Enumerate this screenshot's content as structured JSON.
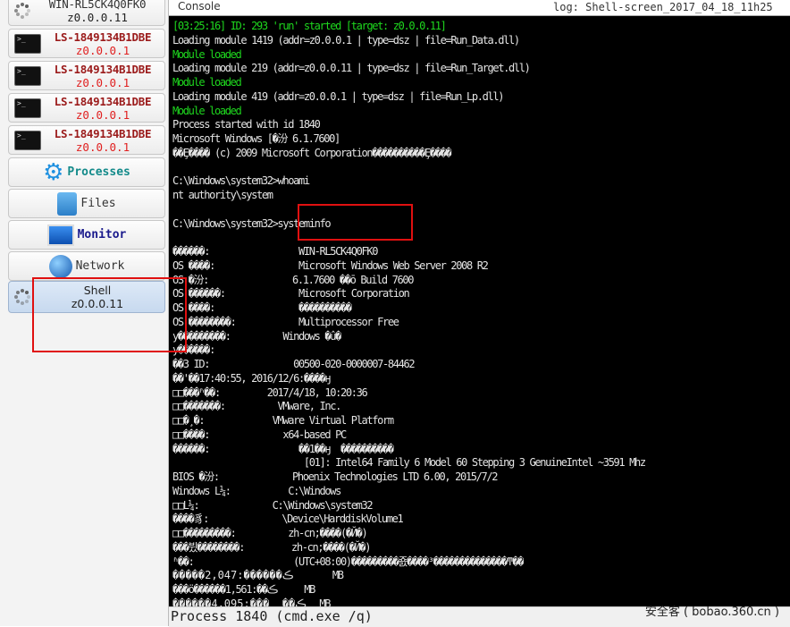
{
  "sidebar": {
    "hosts": [
      {
        "name": "WIN-RL5CK4Q0FK0",
        "addr": "z0.0.0.11",
        "icon": "spinner-icon"
      },
      {
        "name": "LS-1849134B1DBE",
        "addr": "z0.0.0.1",
        "icon": "terminal-icon"
      },
      {
        "name": "LS-1849134B1DBE",
        "addr": "z0.0.0.1",
        "icon": "terminal-icon"
      },
      {
        "name": "LS-1849134B1DBE",
        "addr": "z0.0.0.1",
        "icon": "terminal-icon"
      },
      {
        "name": "LS-1849134B1DBE",
        "addr": "z0.0.0.1",
        "icon": "terminal-icon"
      }
    ],
    "nav": [
      {
        "label": "Processes",
        "icon": "gear-icon",
        "color": "#138a8a"
      },
      {
        "label": "Files",
        "icon": "file-cabinet-icon",
        "color": "#333333"
      },
      {
        "label": "Monitor",
        "icon": "monitor-icon",
        "color": "#1a1a8c"
      },
      {
        "label": "Network",
        "icon": "globe-icon",
        "color": "#333333"
      }
    ],
    "selected": {
      "label": "Shell",
      "addr": "z0.0.0.11",
      "icon": "spinner-icon"
    }
  },
  "console": {
    "title": "Console",
    "log": "log: Shell-screen_2017_04_18_11h25",
    "lines": [
      {
        "t": "[03:25:16] ID: 293 'run' started [target: z0.0.0.11]",
        "c": "g"
      },
      {
        "t": "Loading module 1419 (addr=z0.0.0.1 | type=dsz | file=Run_Data.dll)"
      },
      {
        "t": "Module loaded",
        "c": "g"
      },
      {
        "t": "Loading module 219 (addr=z0.0.0.11 | type=dsz | file=Run_Target.dll)"
      },
      {
        "t": "Module loaded",
        "c": "g"
      },
      {
        "t": "Loading module 419 (addr=z0.0.0.1 | type=dsz | file=Run_Lp.dll)"
      },
      {
        "t": "Module loaded",
        "c": "g"
      },
      {
        "t": "Process started with id 1840"
      },
      {
        "t": "Microsoft Windows [�汾 6.1.7600]"
      },
      {
        "t": "��Ȩ���� (c) 2009 Microsoft Corporation����������Ȩ����"
      },
      {
        "t": ""
      },
      {
        "t": "C:\\Windows\\system32>whoami"
      },
      {
        "t": "nt authority\\system"
      },
      {
        "t": ""
      },
      {
        "t": "C:\\Windows\\system32>systeminfo"
      },
      {
        "t": ""
      },
      {
        "t": "������:                 WIN-RL5CK4Q0FK0"
      },
      {
        "t": "OS ����:                Microsoft Windows Web Server 2008 R2"
      },
      {
        "t": "OS �汾:                6.1.7600 ��ō Build 7600"
      },
      {
        "t": "OS ������:              Microsoft Corporation"
      },
      {
        "t": "OS ����:                ����������"
      },
      {
        "t": "OS ��������:            Multiprocessor Free"
      },
      {
        "t": "y���������:          Windows �û�"
      },
      {
        "t": "y������:"
      },
      {
        "t": "��3 ID:                00500-020-0000007-84462"
      },
      {
        "t": "��'��17:40:55, 2016/12/6:����ӈ"
      },
      {
        "t": "□□���ʱ��:         2017/4/18, 10:20:36"
      },
      {
        "t": "□□�������:          VMware, Inc."
      },
      {
        "t": "□□�¸�:             VMware Virtual Platform"
      },
      {
        "t": "□□����:              x64-based PC"
      },
      {
        "t": "������:                 ��1��ӈ  ����������"
      },
      {
        "t": "                         [01]: Intel64 Family 6 Model 60 Stepping 3 GenuineIntel ~3591 Mhz"
      },
      {
        "t": "BIOS �汾:              Phoenix Technologies LTD 6.00, 2015/7/2"
      },
      {
        "t": "Windows L¼:           C:\\Windows"
      },
      {
        "t": "□□L¼:              C:\\Windows\\system32"
      },
      {
        "t": "����豸:              \\Device\\HarddiskVolume1"
      },
      {
        "t": "□□���������:          zh-cn;����(�Й�)"
      },
      {
        "t": "���뷨��������:         zh-cn;����(�Й�)"
      },
      {
        "t": "ʱ��:                   (UTC+08:00)���������죬����³��������������ͳ��"
      },
      {
        "t": "�����2,047:������ڪ      MB"
      },
      {
        "t": "���ö������1,561:��ڪ    MB"
      },
      {
        "t": "������4,095:���  ��ڪ  MB"
      }
    ]
  },
  "status": {
    "text": "Process 1840 (cmd.exe /q)",
    "watermark": "安全客 ( bobao.360.cn )"
  }
}
